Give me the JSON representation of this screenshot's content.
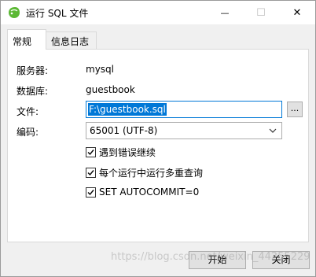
{
  "window": {
    "title": "运行 SQL 文件",
    "minimize_glyph": "—",
    "maximize_glyph": "☐",
    "close_glyph": "✕"
  },
  "tabs": [
    {
      "label": "常规",
      "active": true
    },
    {
      "label": "信息日志",
      "active": false
    }
  ],
  "fields": {
    "server_label": "服务器:",
    "server_value": "mysql",
    "database_label": "数据库:",
    "database_value": "guestbook",
    "file_label": "文件:",
    "file_value": "F:\\guestbook.sql",
    "browse_label": "...",
    "encoding_label": "编码:",
    "encoding_value": "65001 (UTF-8)"
  },
  "options": [
    {
      "label": "遇到错误继续",
      "checked": true
    },
    {
      "label": "每个运行中运行多重查询",
      "checked": true
    },
    {
      "label": "SET AUTOCOMMIT=0",
      "checked": true
    }
  ],
  "buttons": {
    "start": "开始",
    "close": "关闭"
  },
  "watermark": "https://blog.csdn.net/weixin_44255229",
  "icons": {
    "app": "leaf-icon",
    "checkbox": "check-icon",
    "dropdown": "chevron-down-icon"
  },
  "colors": {
    "accent": "#0078d7",
    "app_icon": "#5bb834"
  }
}
